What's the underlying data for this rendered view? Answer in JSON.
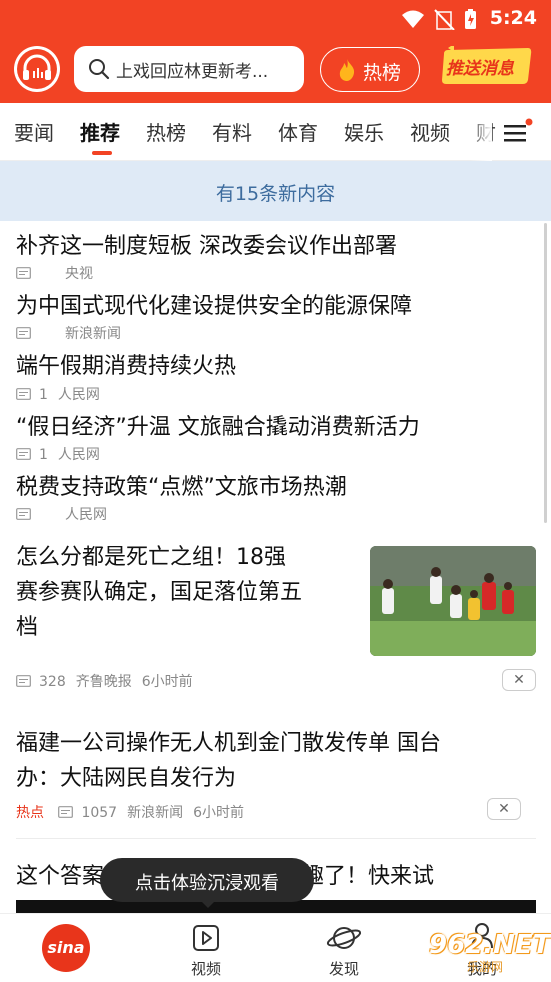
{
  "status": {
    "time": "5:24"
  },
  "header": {
    "search_placeholder": "上戏回应林更新考...",
    "hot_button": "热榜",
    "push_badge": "推送消息"
  },
  "tabs": [
    "要闻",
    "推荐",
    "热榜",
    "有料",
    "体育",
    "娱乐",
    "视频",
    "财"
  ],
  "active_tab": "推荐",
  "banner": "有15条新内容",
  "news": [
    {
      "title": "补齐这一制度短板 深改委会议作出部署",
      "count": "",
      "source": "央视"
    },
    {
      "title": "为中国式现代化建设提供安全的能源保障",
      "count": "",
      "source": "新浪新闻"
    },
    {
      "title": "端午假期消费持续火热",
      "count": "1",
      "source": "人民网"
    },
    {
      "title": "“假日经济”升温 文旅融合撬动消费新活力",
      "count": "1",
      "source": "人民网"
    },
    {
      "title": "税费支持政策“点燃”文旅市场热潮",
      "count": "",
      "source": "人民网"
    }
  ],
  "feature": {
    "title_lines": [
      "怎么分都是死亡之组！18强",
      "赛参赛队确定，国足落位第五",
      "档"
    ],
    "count": "328",
    "source": "齐鲁晚报",
    "time": "6小时前"
  },
  "article2": {
    "title_lines": [
      "福建一公司操作无人机到金门散发传单 国台",
      "办：大陆网民自发行为"
    ],
    "tag": "热点",
    "count": "1057",
    "source": "新浪新闻",
    "time": "6小时前"
  },
  "article3": {
    "title": "这个答案真的意想不到，太有趣了！快来试"
  },
  "tooltip": "点击体验沉浸观看",
  "bottom_nav": {
    "video": "视频",
    "discover": "发现",
    "me": "我的"
  },
  "logo_text": "sina",
  "watermark": {
    "main": "962.NET",
    "sub": "乐游网"
  }
}
